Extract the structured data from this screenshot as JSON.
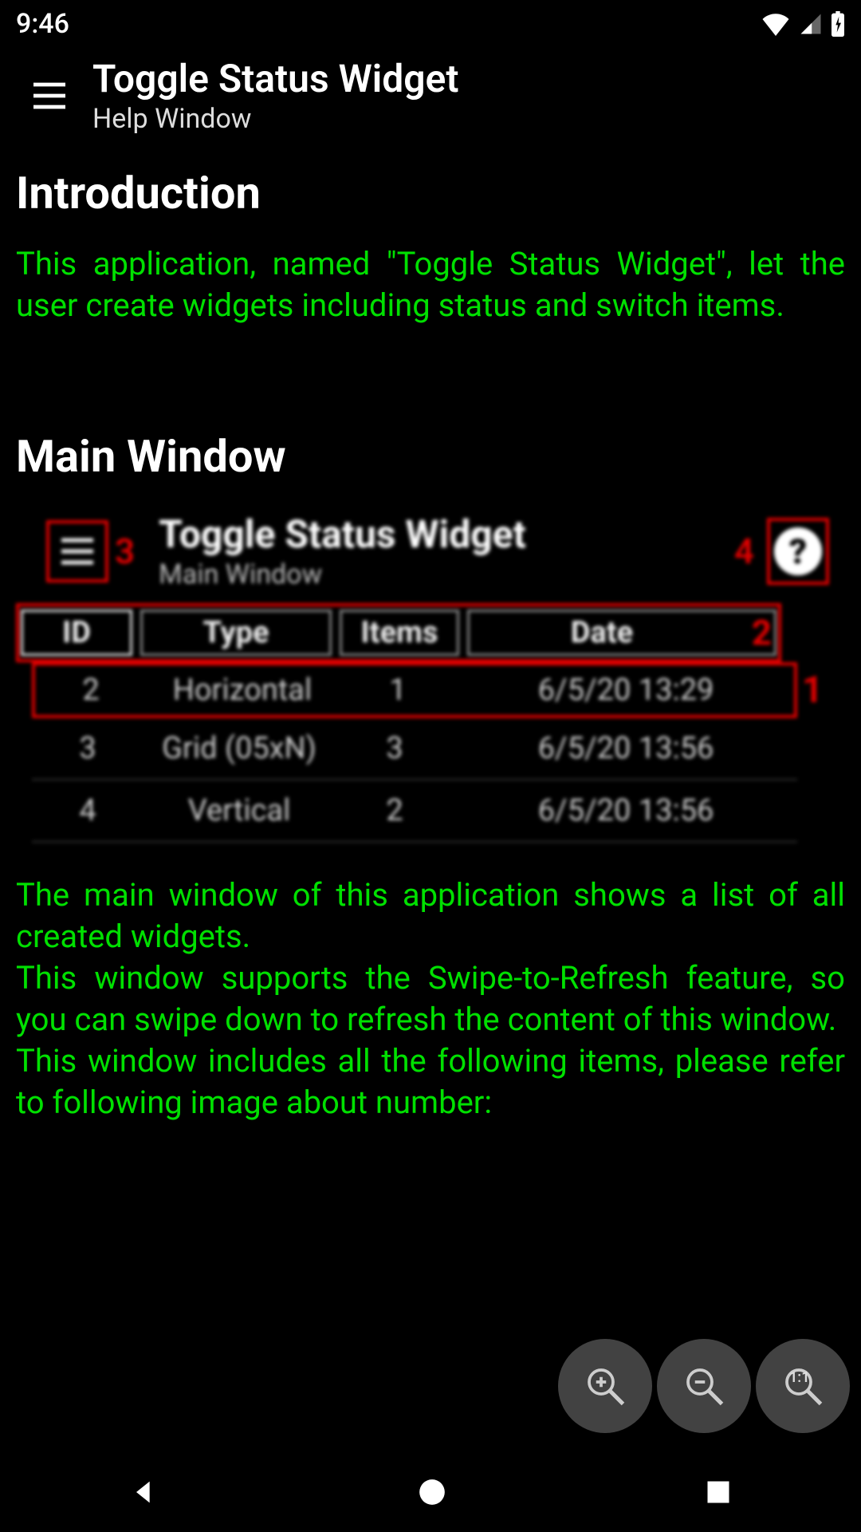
{
  "status_bar": {
    "time": "9:46"
  },
  "app_bar": {
    "title": "Toggle Status Widget",
    "subtitle": "Help Window"
  },
  "sections": {
    "intro_heading": "Introduction",
    "intro_body": "This application, named \"Toggle Status Widget\", let the user create widgets including status and switch items.",
    "mainwin_heading": "Main Window",
    "mainwin_body_p1": "The main window of this application shows a list of all created widgets.",
    "mainwin_body_p2": "This window supports the Swipe-to-Refresh feature, so you can swipe down to refresh the content of this window.",
    "mainwin_body_p3": "This window includes all the following items, please refer to following image about number:"
  },
  "embedded": {
    "title": "Toggle Status Widget",
    "subtitle": "Main Window",
    "annot_hamburger": "3",
    "annot_help": "4",
    "annot_header": "2",
    "annot_row": "1",
    "help_glyph": "?",
    "headers": {
      "id": "ID",
      "type": "Type",
      "items": "Items",
      "date": "Date"
    },
    "rows": [
      {
        "id": "2",
        "type": "Horizontal",
        "items": "1",
        "date": "6/5/20 13:29"
      },
      {
        "id": "3",
        "type": "Grid (05xN)",
        "items": "3",
        "date": "6/5/20 13:56"
      },
      {
        "id": "4",
        "type": "Vertical",
        "items": "2",
        "date": "6/5/20 13:56"
      }
    ]
  },
  "fab": {
    "oneone_label": "1:1"
  }
}
